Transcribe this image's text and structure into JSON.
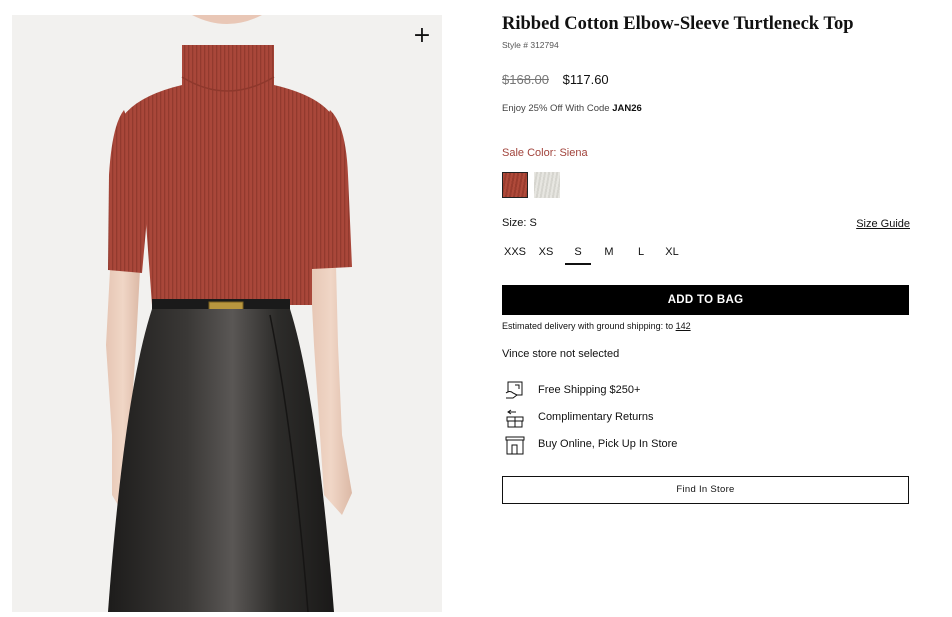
{
  "product": {
    "title": "Ribbed Cotton Elbow-Sleeve Turtleneck Top",
    "style_number": "Style # 312794",
    "zoom_symbol": "+"
  },
  "price": {
    "original": "$168.00",
    "sale": "$117.60"
  },
  "promo": {
    "text": "Enjoy 25% Off With Code ",
    "code": "JAN26"
  },
  "color": {
    "label": "Sale Color: Siena",
    "swatches": [
      {
        "name": "Siena",
        "hex": "#a9473a",
        "selected": true
      },
      {
        "name": "Ivory",
        "hex": "#e2e1dc",
        "selected": false
      }
    ]
  },
  "size": {
    "label": "Size: S",
    "guide_label": "Size Guide",
    "options": [
      "XXS",
      "XS",
      "S",
      "M",
      "L",
      "XL"
    ],
    "selected": "S"
  },
  "actions": {
    "add_to_bag": "ADD TO BAG",
    "find_in_store": "Find In Store"
  },
  "delivery": {
    "text": "Estimated delivery with ground shipping: to ",
    "zip_link": "142"
  },
  "store": {
    "status": "Vince store not selected"
  },
  "perks": [
    {
      "icon": "shipping-icon",
      "label": "Free Shipping $250+"
    },
    {
      "icon": "returns-icon",
      "label": "Complimentary Returns"
    },
    {
      "icon": "store-pickup-icon",
      "label": "Buy Online, Pick Up In Store"
    }
  ],
  "colors": {
    "accent_sale": "#a1433b",
    "button_bg": "#000000",
    "top_fabric": "#a9473a",
    "skirt_leather": "#2b2a29",
    "image_bg": "#f2f1ef"
  }
}
